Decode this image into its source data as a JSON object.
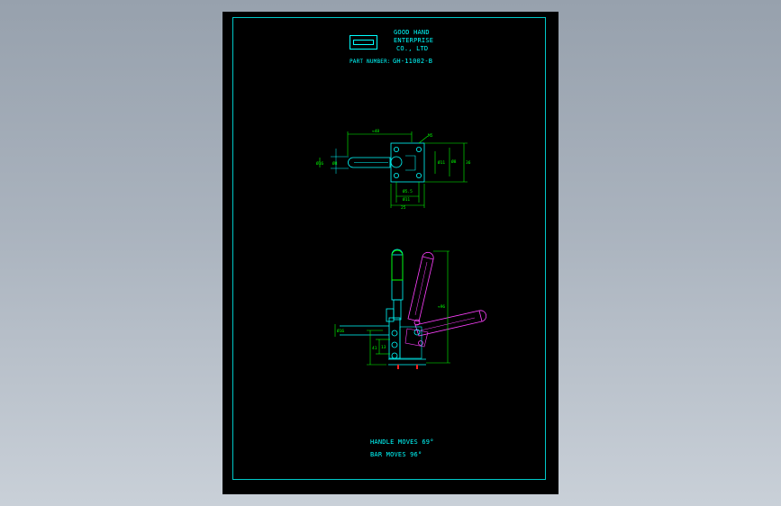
{
  "title_block": {
    "company_line1": "GOOD HAND",
    "company_line2": "ENTERPRISE",
    "company_line3": "CO., LTD",
    "part_number_label": "PART NUMBER:",
    "part_number_value": "GH-11002-B"
  },
  "notes": {
    "handle_moves": "HANDLE MOVES 69°",
    "bar_moves": "BAR    MOVES 96°"
  },
  "colors": {
    "workspace": "#a3adb8",
    "sheet": "#000000",
    "line": "#00ffff",
    "magenta": "#ff40ff",
    "green": "#00ff00",
    "red": "#ff2020"
  },
  "icons": {
    "logo": "company-logo-icon"
  }
}
